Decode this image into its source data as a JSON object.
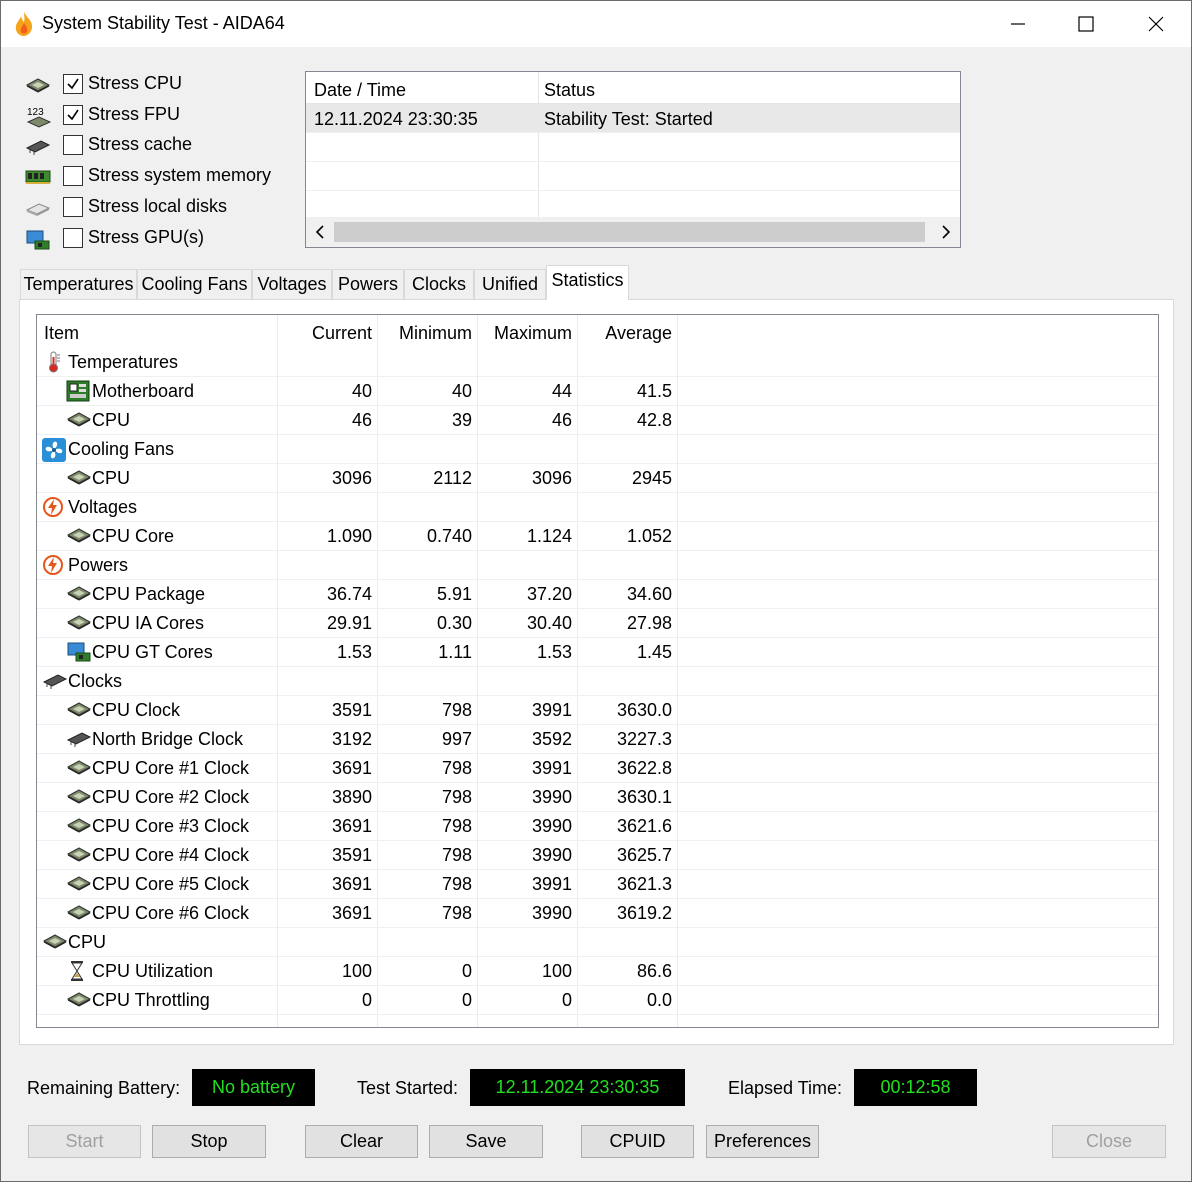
{
  "window": {
    "title": "System Stability Test - AIDA64"
  },
  "options": [
    {
      "label": "Stress CPU",
      "checked": true,
      "icon": "cpu-chip-icon"
    },
    {
      "label": "Stress FPU",
      "checked": true,
      "icon": "fpu-123-icon"
    },
    {
      "label": "Stress cache",
      "checked": false,
      "icon": "cache-chip-icon"
    },
    {
      "label": "Stress system memory",
      "checked": false,
      "icon": "memory-module-icon"
    },
    {
      "label": "Stress local disks",
      "checked": false,
      "icon": "disk-drive-icon"
    },
    {
      "label": "Stress GPU(s)",
      "checked": false,
      "icon": "monitor-gpu-icon"
    }
  ],
  "log": {
    "col_datetime": "Date / Time",
    "col_status": "Status",
    "rows": [
      {
        "datetime": "12.11.2024 23:30:35",
        "status": "Stability Test: Started"
      }
    ]
  },
  "tabs": [
    "Temperatures",
    "Cooling Fans",
    "Voltages",
    "Powers",
    "Clocks",
    "Unified",
    "Statistics"
  ],
  "active_tab": "Statistics",
  "stats": {
    "headers": {
      "item": "Item",
      "current": "Current",
      "minimum": "Minimum",
      "maximum": "Maximum",
      "average": "Average"
    },
    "rows": [
      {
        "type": "group",
        "icon": "thermometer-icon",
        "label": "Temperatures"
      },
      {
        "type": "item",
        "icon": "motherboard-icon",
        "label": "Motherboard",
        "cur": "40",
        "min": "40",
        "max": "44",
        "avg": "41.5"
      },
      {
        "type": "item",
        "icon": "cpu-chip-icon",
        "label": "CPU",
        "cur": "46",
        "min": "39",
        "max": "46",
        "avg": "42.8"
      },
      {
        "type": "group",
        "icon": "fan-icon",
        "label": "Cooling Fans"
      },
      {
        "type": "item",
        "icon": "cpu-chip-icon",
        "label": "CPU",
        "cur": "3096",
        "min": "2112",
        "max": "3096",
        "avg": "2945"
      },
      {
        "type": "group",
        "icon": "lightning-icon",
        "label": "Voltages"
      },
      {
        "type": "item",
        "icon": "cpu-chip-icon",
        "label": "CPU Core",
        "cur": "1.090",
        "min": "0.740",
        "max": "1.124",
        "avg": "1.052"
      },
      {
        "type": "group",
        "icon": "lightning-icon",
        "label": "Powers"
      },
      {
        "type": "item",
        "icon": "cpu-chip-icon",
        "label": "CPU Package",
        "cur": "36.74",
        "min": "5.91",
        "max": "37.20",
        "avg": "34.60"
      },
      {
        "type": "item",
        "icon": "cpu-chip-icon",
        "label": "CPU IA Cores",
        "cur": "29.91",
        "min": "0.30",
        "max": "30.40",
        "avg": "27.98"
      },
      {
        "type": "item",
        "icon": "monitor-gpu-icon",
        "label": "CPU GT Cores",
        "cur": "1.53",
        "min": "1.11",
        "max": "1.53",
        "avg": "1.45"
      },
      {
        "type": "group",
        "icon": "clock-chip-icon",
        "label": "Clocks"
      },
      {
        "type": "item",
        "icon": "cpu-chip-icon",
        "label": "CPU Clock",
        "cur": "3591",
        "min": "798",
        "max": "3991",
        "avg": "3630.0"
      },
      {
        "type": "item",
        "icon": "northbridge-chip-icon",
        "label": "North Bridge Clock",
        "cur": "3192",
        "min": "997",
        "max": "3592",
        "avg": "3227.3"
      },
      {
        "type": "item",
        "icon": "cpu-chip-icon",
        "label": "CPU Core #1 Clock",
        "cur": "3691",
        "min": "798",
        "max": "3991",
        "avg": "3622.8"
      },
      {
        "type": "item",
        "icon": "cpu-chip-icon",
        "label": "CPU Core #2 Clock",
        "cur": "3890",
        "min": "798",
        "max": "3990",
        "avg": "3630.1"
      },
      {
        "type": "item",
        "icon": "cpu-chip-icon",
        "label": "CPU Core #3 Clock",
        "cur": "3691",
        "min": "798",
        "max": "3990",
        "avg": "3621.6"
      },
      {
        "type": "item",
        "icon": "cpu-chip-icon",
        "label": "CPU Core #4 Clock",
        "cur": "3591",
        "min": "798",
        "max": "3990",
        "avg": "3625.7"
      },
      {
        "type": "item",
        "icon": "cpu-chip-icon",
        "label": "CPU Core #5 Clock",
        "cur": "3691",
        "min": "798",
        "max": "3991",
        "avg": "3621.3"
      },
      {
        "type": "item",
        "icon": "cpu-chip-icon",
        "label": "CPU Core #6 Clock",
        "cur": "3691",
        "min": "798",
        "max": "3990",
        "avg": "3619.2"
      },
      {
        "type": "group",
        "icon": "cpu-chip-icon",
        "label": "CPU"
      },
      {
        "type": "item",
        "icon": "hourglass-icon",
        "label": "CPU Utilization",
        "cur": "100",
        "min": "0",
        "max": "100",
        "avg": "86.6"
      },
      {
        "type": "item",
        "icon": "cpu-chip-icon",
        "label": "CPU Throttling",
        "cur": "0",
        "min": "0",
        "max": "0",
        "avg": "0.0"
      }
    ]
  },
  "status": {
    "battery_label": "Remaining Battery:",
    "battery_value": "No battery",
    "started_label": "Test Started:",
    "started_value": "12.11.2024 23:30:35",
    "elapsed_label": "Elapsed Time:",
    "elapsed_value": "00:12:58",
    "value_color": "#22e01f"
  },
  "buttons": {
    "start": {
      "label": "Start",
      "enabled": false
    },
    "stop": {
      "label": "Stop",
      "enabled": true
    },
    "clear": {
      "label": "Clear",
      "enabled": true
    },
    "save": {
      "label": "Save",
      "enabled": true
    },
    "cpuid": {
      "label": "CPUID",
      "enabled": true
    },
    "preferences": {
      "label": "Preferences",
      "enabled": true
    },
    "close": {
      "label": "Close",
      "enabled": false
    }
  }
}
